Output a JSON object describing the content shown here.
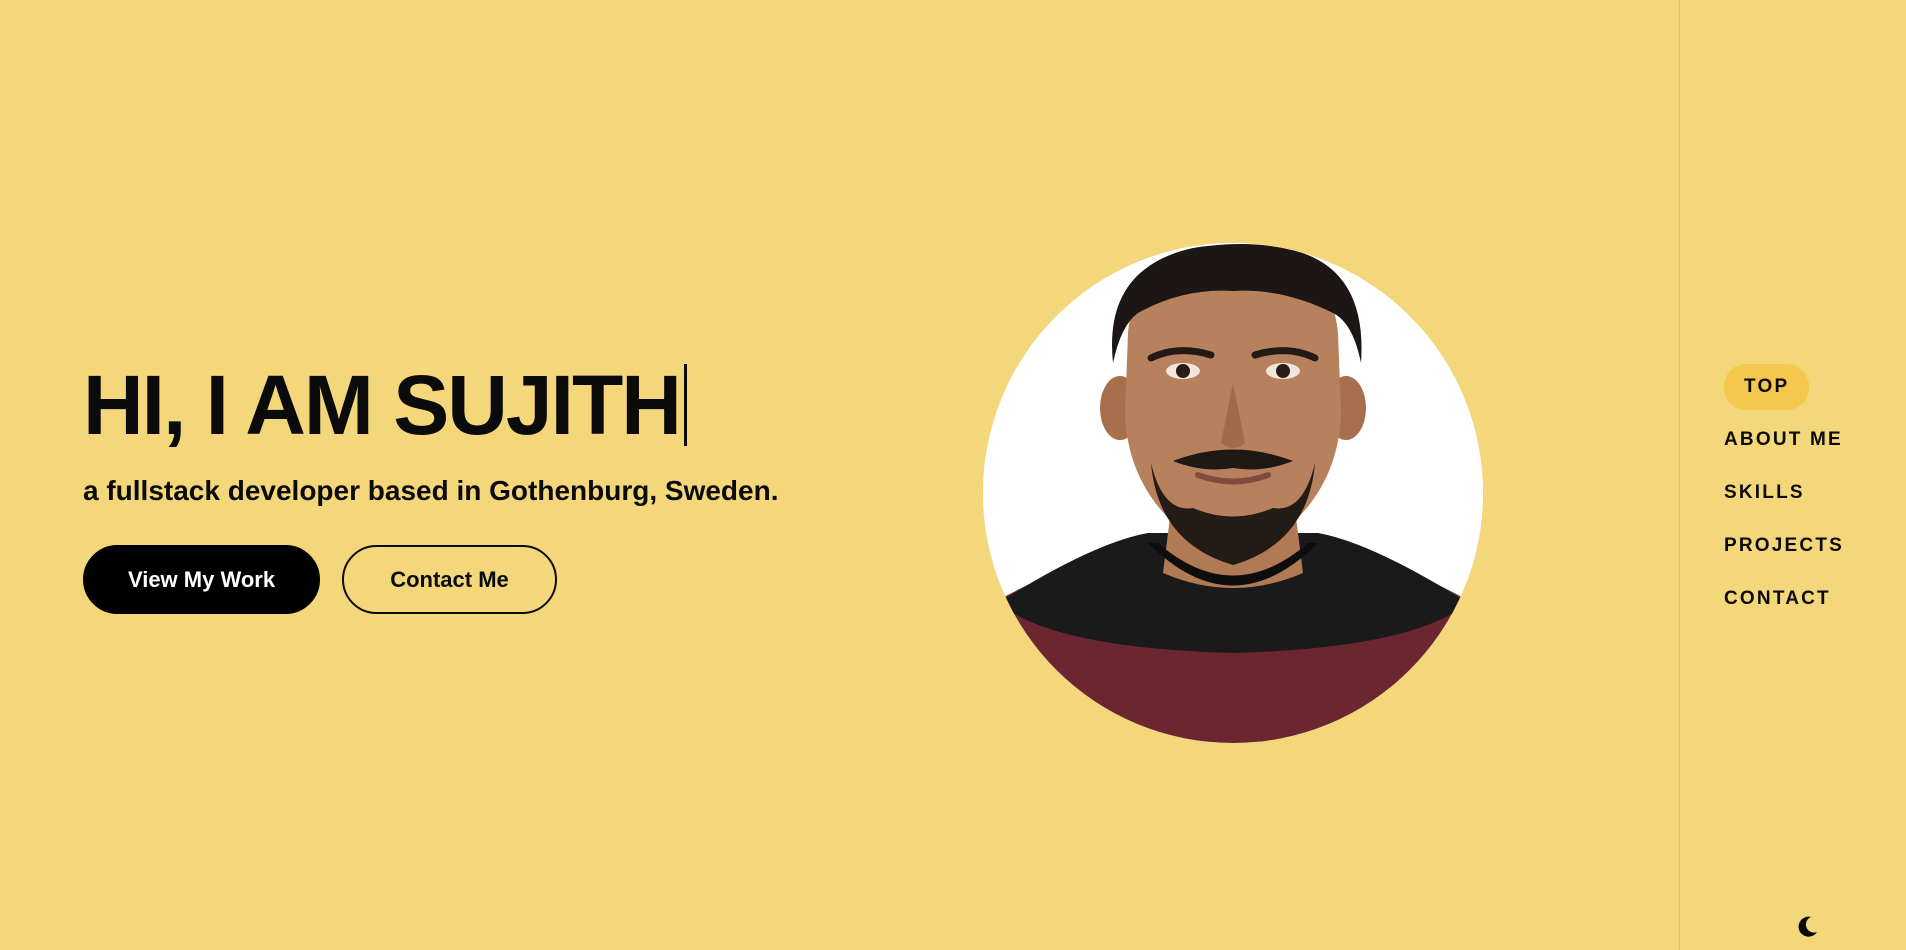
{
  "hero": {
    "title": "HI, I AM SUJITH",
    "subtitle": "a fullstack developer based in Gothenburg, Sweden.",
    "primary_button": "View My Work",
    "secondary_button": "Contact Me"
  },
  "nav": {
    "items": [
      {
        "label": "TOP",
        "active": true
      },
      {
        "label": "ABOUT ME",
        "active": false
      },
      {
        "label": "SKILLS",
        "active": false
      },
      {
        "label": "PROJECTS",
        "active": false
      },
      {
        "label": "CONTACT",
        "active": false
      }
    ],
    "theme_toggle_icon": "moon-icon"
  },
  "profile": {
    "image_icon": "profile-photo"
  },
  "colors": {
    "background": "#f3d77a",
    "accent": "#f4c84c",
    "text": "#0b0b0b",
    "primary_button_bg": "#000000"
  }
}
